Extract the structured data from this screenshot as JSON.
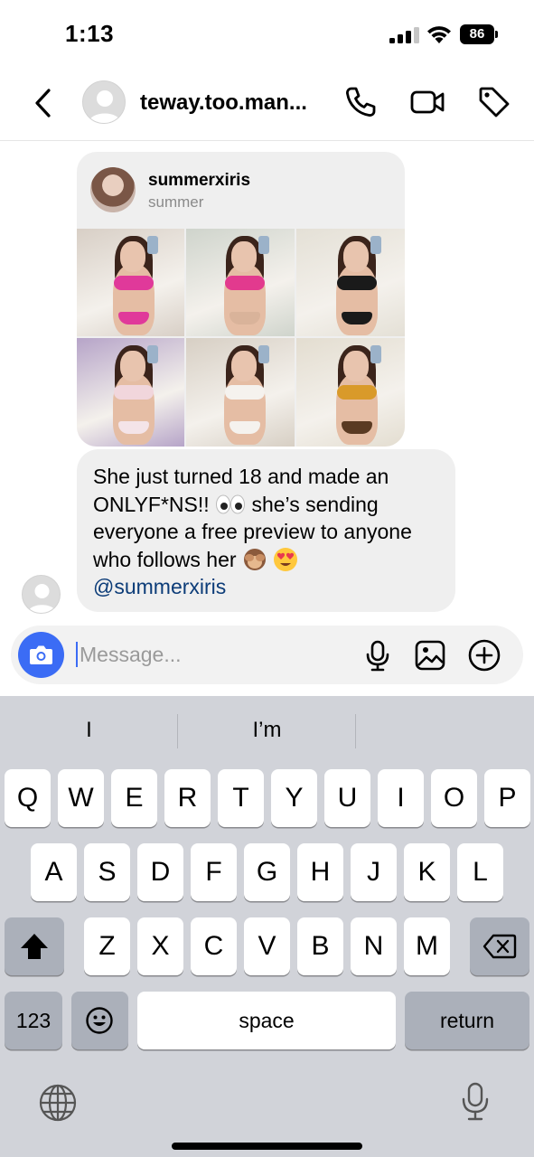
{
  "status_bar": {
    "time": "1:13",
    "battery": "86"
  },
  "header": {
    "title": "teway.too.man..."
  },
  "post": {
    "username": "summerxiris",
    "display_name": "summer",
    "photos": [
      {
        "alt": "photo-1",
        "bg": "#d8cfc6",
        "top": "#e0399a",
        "bottom": "#e0399a"
      },
      {
        "alt": "photo-2",
        "bg": "#cfd4cc",
        "top": "#e23a8e",
        "bottom": "#d9b39a"
      },
      {
        "alt": "photo-3",
        "bg": "#e4e0d6",
        "top": "#1a1a1a",
        "bottom": "#1a1a1a"
      },
      {
        "alt": "photo-4",
        "bg": "#b6a4c8",
        "top": "#f1d6dc",
        "bottom": "#f4e4e8"
      },
      {
        "alt": "photo-5",
        "bg": "#d7cfc4",
        "top": "#f5f2ee",
        "bottom": "#f5f2ee"
      },
      {
        "alt": "photo-6",
        "bg": "#e3ddd0",
        "top": "#d99a2a",
        "bottom": "#5a3a22"
      }
    ]
  },
  "message": {
    "lines": [
      "She just turned 18 and made an",
      "ONLYF*NS!!",
      "she’s sending",
      "everyone a free preview to anyone",
      "who follows her",
      "@summerxiris"
    ]
  },
  "composer": {
    "placeholder": "Message..."
  },
  "keyboard": {
    "suggestions": [
      "I",
      "I’m",
      ""
    ],
    "row1": [
      "Q",
      "W",
      "E",
      "R",
      "T",
      "Y",
      "U",
      "I",
      "O",
      "P"
    ],
    "row2": [
      "A",
      "S",
      "D",
      "F",
      "G",
      "H",
      "J",
      "K",
      "L"
    ],
    "row3": [
      "Z",
      "X",
      "C",
      "V",
      "B",
      "N",
      "M"
    ],
    "numbers_label": "123",
    "space_label": "space",
    "return_label": "return"
  },
  "colors": {
    "accent": "#3b6cf5",
    "mention": "#0c3c78",
    "bubble": "#efefef",
    "keyboard_bg": "#d1d3d9"
  },
  "icons": [
    "back-icon",
    "phone-icon",
    "video-icon",
    "tag-icon",
    "camera-icon",
    "mic-icon",
    "image-icon",
    "plus-icon",
    "shift-icon",
    "delete-icon",
    "emoji-icon",
    "globe-icon",
    "dictation-icon"
  ]
}
